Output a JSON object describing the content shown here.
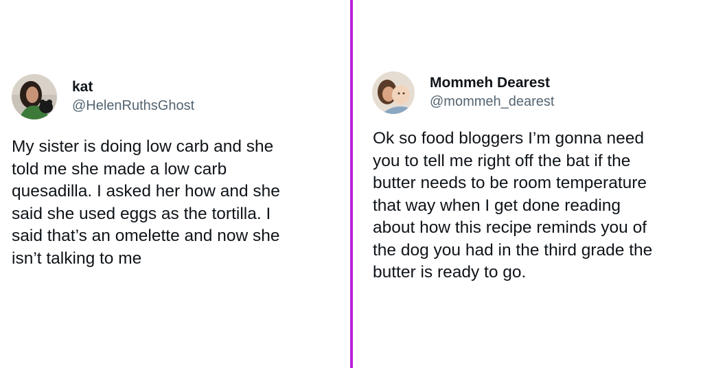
{
  "colors": {
    "divider": "#b820d6",
    "name_text": "#0f1419",
    "handle_text": "#536471",
    "body_text": "#0f1419"
  },
  "tweets": [
    {
      "display_name": "kat",
      "handle": "@HelenRuthsGhost",
      "avatar_icon": "profile-photo",
      "text": "My sister is doing low carb and she\ntold me she made a low carb\nquesadilla. I asked her how and she\nsaid she used eggs as the tortilla. I\nsaid that’s an omelette and now she\nisn’t talking to me"
    },
    {
      "display_name": "Mommeh Dearest",
      "handle": "@mommeh_dearest",
      "avatar_icon": "profile-photo",
      "text": "Ok so food bloggers I’m gonna need\nyou to tell me right off the bat if the\nbutter needs to be room temperature\nthat way when I get done reading\nabout how this recipe reminds you of\nthe dog you had in the third grade the\nbutter is ready to go."
    }
  ]
}
